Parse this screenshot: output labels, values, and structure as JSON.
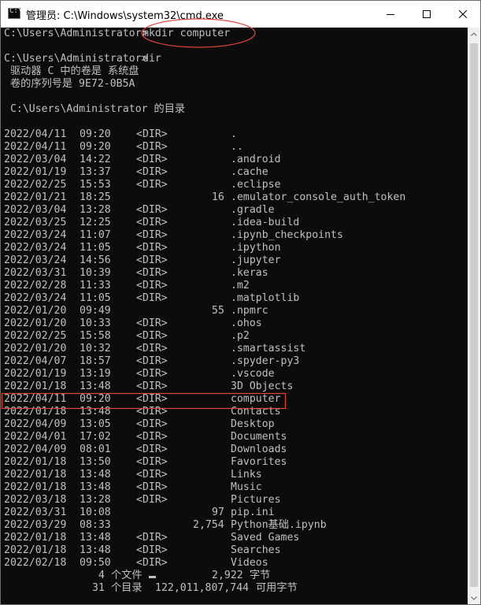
{
  "window": {
    "title": "管理员: C:\\Windows\\system32\\cmd.exe",
    "app_icon_glyph": "C:\\",
    "minimize_icon": "minimize-icon",
    "maximize_icon": "maximize-icon",
    "close_icon": "close-icon"
  },
  "colors": {
    "console_bg": "#0c0c0c",
    "console_text": "#c0c0c0",
    "annotation": "#e0453c"
  },
  "console": {
    "mkdir_prompt": "C:\\Users\\Administrator>",
    "mkdir_command": "mkdir computer",
    "dir_prompt": "C:\\Users\\Administrator>",
    "dir_command": "dir",
    "volume_line": " 驱动器 C 中的卷是 系统盘",
    "serial_line": " 卷的序列号是 9E72-0B5A",
    "directory_line": " C:\\Users\\Administrator 的目录",
    "entries": [
      {
        "date": "2022/04/11",
        "time": "09:20",
        "type": "<DIR>",
        "size": "",
        "name": "."
      },
      {
        "date": "2022/04/11",
        "time": "09:20",
        "type": "<DIR>",
        "size": "",
        "name": ".."
      },
      {
        "date": "2022/03/04",
        "time": "14:22",
        "type": "<DIR>",
        "size": "",
        "name": ".android"
      },
      {
        "date": "2022/01/19",
        "time": "13:37",
        "type": "<DIR>",
        "size": "",
        "name": ".cache"
      },
      {
        "date": "2022/02/25",
        "time": "15:53",
        "type": "<DIR>",
        "size": "",
        "name": ".eclipse"
      },
      {
        "date": "2022/01/21",
        "time": "18:25",
        "type": "",
        "size": "16",
        "name": ".emulator_console_auth_token"
      },
      {
        "date": "2022/03/04",
        "time": "13:28",
        "type": "<DIR>",
        "size": "",
        "name": ".gradle"
      },
      {
        "date": "2022/03/25",
        "time": "12:25",
        "type": "<DIR>",
        "size": "",
        "name": ".idea-build"
      },
      {
        "date": "2022/03/24",
        "time": "11:07",
        "type": "<DIR>",
        "size": "",
        "name": ".ipynb_checkpoints"
      },
      {
        "date": "2022/03/24",
        "time": "11:05",
        "type": "<DIR>",
        "size": "",
        "name": ".ipython"
      },
      {
        "date": "2022/03/24",
        "time": "14:56",
        "type": "<DIR>",
        "size": "",
        "name": ".jupyter"
      },
      {
        "date": "2022/03/31",
        "time": "10:39",
        "type": "<DIR>",
        "size": "",
        "name": ".keras"
      },
      {
        "date": "2022/02/28",
        "time": "11:33",
        "type": "<DIR>",
        "size": "",
        "name": ".m2"
      },
      {
        "date": "2022/03/24",
        "time": "11:05",
        "type": "<DIR>",
        "size": "",
        "name": ".matplotlib"
      },
      {
        "date": "2022/01/20",
        "time": "09:49",
        "type": "",
        "size": "55",
        "name": ".npmrc"
      },
      {
        "date": "2022/01/20",
        "time": "10:33",
        "type": "<DIR>",
        "size": "",
        "name": ".ohos"
      },
      {
        "date": "2022/02/25",
        "time": "15:58",
        "type": "<DIR>",
        "size": "",
        "name": ".p2"
      },
      {
        "date": "2022/01/20",
        "time": "10:32",
        "type": "<DIR>",
        "size": "",
        "name": ".smartassist"
      },
      {
        "date": "2022/04/07",
        "time": "18:57",
        "type": "<DIR>",
        "size": "",
        "name": ".spyder-py3"
      },
      {
        "date": "2022/01/19",
        "time": "13:19",
        "type": "<DIR>",
        "size": "",
        "name": ".vscode"
      },
      {
        "date": "2022/01/18",
        "time": "13:48",
        "type": "<DIR>",
        "size": "",
        "name": "3D Objects"
      },
      {
        "date": "2022/04/11",
        "time": "09:20",
        "type": "<DIR>",
        "size": "",
        "name": "computer"
      },
      {
        "date": "2022/01/18",
        "time": "13:48",
        "type": "<DIR>",
        "size": "",
        "name": "Contacts"
      },
      {
        "date": "2022/04/09",
        "time": "13:05",
        "type": "<DIR>",
        "size": "",
        "name": "Desktop"
      },
      {
        "date": "2022/04/01",
        "time": "17:02",
        "type": "<DIR>",
        "size": "",
        "name": "Documents"
      },
      {
        "date": "2022/04/09",
        "time": "08:01",
        "type": "<DIR>",
        "size": "",
        "name": "Downloads"
      },
      {
        "date": "2022/01/18",
        "time": "13:50",
        "type": "<DIR>",
        "size": "",
        "name": "Favorites"
      },
      {
        "date": "2022/01/18",
        "time": "13:48",
        "type": "<DIR>",
        "size": "",
        "name": "Links"
      },
      {
        "date": "2022/01/18",
        "time": "13:48",
        "type": "<DIR>",
        "size": "",
        "name": "Music"
      },
      {
        "date": "2022/03/18",
        "time": "13:28",
        "type": "<DIR>",
        "size": "",
        "name": "Pictures"
      },
      {
        "date": "2022/03/31",
        "time": "10:08",
        "type": "",
        "size": "97",
        "name": "pip.ini"
      },
      {
        "date": "2022/03/29",
        "time": "08:33",
        "type": "",
        "size": "2,754",
        "name": "Python基础.ipynb"
      },
      {
        "date": "2022/01/18",
        "time": "13:48",
        "type": "<DIR>",
        "size": "",
        "name": "Saved Games"
      },
      {
        "date": "2022/01/18",
        "time": "13:48",
        "type": "<DIR>",
        "size": "",
        "name": "Searches"
      },
      {
        "date": "2022/02/18",
        "time": "09:50",
        "type": "<DIR>",
        "size": "",
        "name": "Videos"
      }
    ],
    "files_summary": {
      "count": "4",
      "label": "个文件",
      "bytes": "2,922",
      "unit": "字节"
    },
    "dirs_summary": {
      "count": "31",
      "label": "个目录",
      "bytes": "122,011,807,744",
      "unit": "可用字节"
    }
  }
}
